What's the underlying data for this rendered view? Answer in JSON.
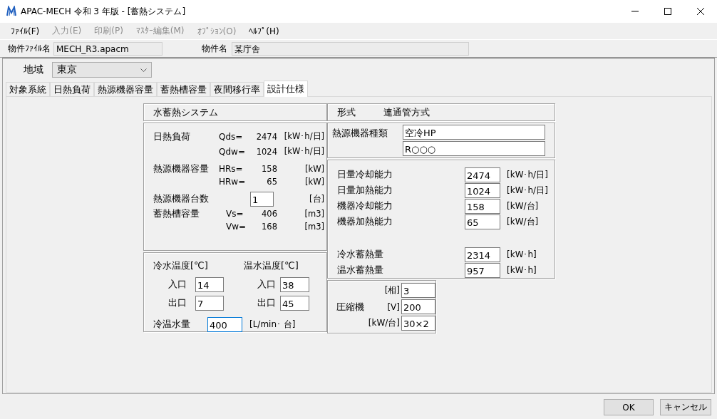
{
  "window": {
    "title": "APAC-MECH 令和 3 年版 - [蓄熱システム]"
  },
  "menu": [
    {
      "label": "ﾌｧｲﾙ(F)",
      "disabled": false
    },
    {
      "label": "入力(E)",
      "disabled": true
    },
    {
      "label": "印刷(P)",
      "disabled": true
    },
    {
      "label": "ﾏｽﾀｰ編集(M)",
      "disabled": true
    },
    {
      "label": "ｵﾌﾟｼｮﾝ(O)",
      "disabled": true
    },
    {
      "label": "ﾍﾙﾌﾟ(H)",
      "disabled": false
    }
  ],
  "project": [
    {
      "label": "物件ﾌｧｲﾙ名",
      "value": "MECH_R3.apacm"
    },
    {
      "label": "物件名",
      "value": "某庁舎"
    }
  ],
  "region": {
    "label": "地域",
    "value": "東京"
  },
  "tabs": [
    {
      "label": "対象系統",
      "selected": false
    },
    {
      "label": "日熱負荷",
      "selected": false
    },
    {
      "label": "熱源機器容量",
      "selected": false
    },
    {
      "label": "蓄熱槽容量",
      "selected": false
    },
    {
      "label": "夜間移行率",
      "selected": false
    },
    {
      "label": "設計仕様",
      "selected": true
    }
  ],
  "system": {
    "title": "水蓄熱システム"
  },
  "summary": [
    {
      "kind": "readout",
      "label": "日熱負荷",
      "lines": [
        {
          "symbol": "Qds=",
          "value": "2474",
          "unit": "[kW･h/日]"
        },
        {
          "symbol": "Qdw=",
          "value": "1024",
          "unit": "[kW･h/日]"
        }
      ]
    },
    {
      "kind": "readout",
      "label": "熱源機器容量",
      "lines": [
        {
          "symbol": "HRs=",
          "value": "158",
          "unit": "[kW]"
        },
        {
          "symbol": "HRw=",
          "value": "65",
          "unit": "[kW]"
        }
      ]
    },
    {
      "kind": "input",
      "label": "熱源機器台数",
      "value": "1",
      "unit": "[台]"
    },
    {
      "kind": "readout",
      "label": "蓄熱槽容量",
      "lines": [
        {
          "symbol": "Vs=",
          "value": "406",
          "unit": "[m3]"
        },
        {
          "symbol": "Vw=",
          "value": "168",
          "unit": "[m3]"
        }
      ]
    }
  ],
  "temperatures": [
    {
      "title": "冷水温度[℃]",
      "inlet_label": "入口",
      "inlet": "14",
      "outlet_label": "出口",
      "outlet": "7"
    },
    {
      "title": "温水温度[℃]",
      "inlet_label": "入口",
      "inlet": "38",
      "outlet_label": "出口",
      "outlet": "45"
    }
  ],
  "flow": {
    "label": "冷温水量",
    "value": "400",
    "unit": "[L/min･ 台]",
    "focused": true
  },
  "type": {
    "label": "形式",
    "value": "連通管方式"
  },
  "source": {
    "label": "熱源機器種類",
    "values": [
      "空冷HP",
      "R○○○"
    ]
  },
  "capacities": [
    {
      "label": "日量冷却能力",
      "value": "2474",
      "unit": "[kW･h/日]"
    },
    {
      "label": "日量加熱能力",
      "value": "1024",
      "unit": "[kW･h/日]"
    },
    {
      "label": "機器冷却能力",
      "value": "158",
      "unit": "[kW/台]"
    },
    {
      "label": "機器加熱能力",
      "value": "65",
      "unit": "[kW/台]"
    }
  ],
  "storage": [
    {
      "label": "冷水蓄熱量",
      "value": "2314",
      "unit": "[kW･h]"
    },
    {
      "label": "温水蓄熱量",
      "value": "957",
      "unit": "[kW･h]"
    }
  ],
  "compressor": {
    "label": "圧縮機",
    "rows": [
      {
        "unit": "[相]",
        "value": "3"
      },
      {
        "unit": "[V]",
        "value": "200"
      },
      {
        "unit": "[kW/台]",
        "value": "30×2"
      }
    ]
  },
  "buttons": [
    "OK",
    "キャンセル"
  ]
}
